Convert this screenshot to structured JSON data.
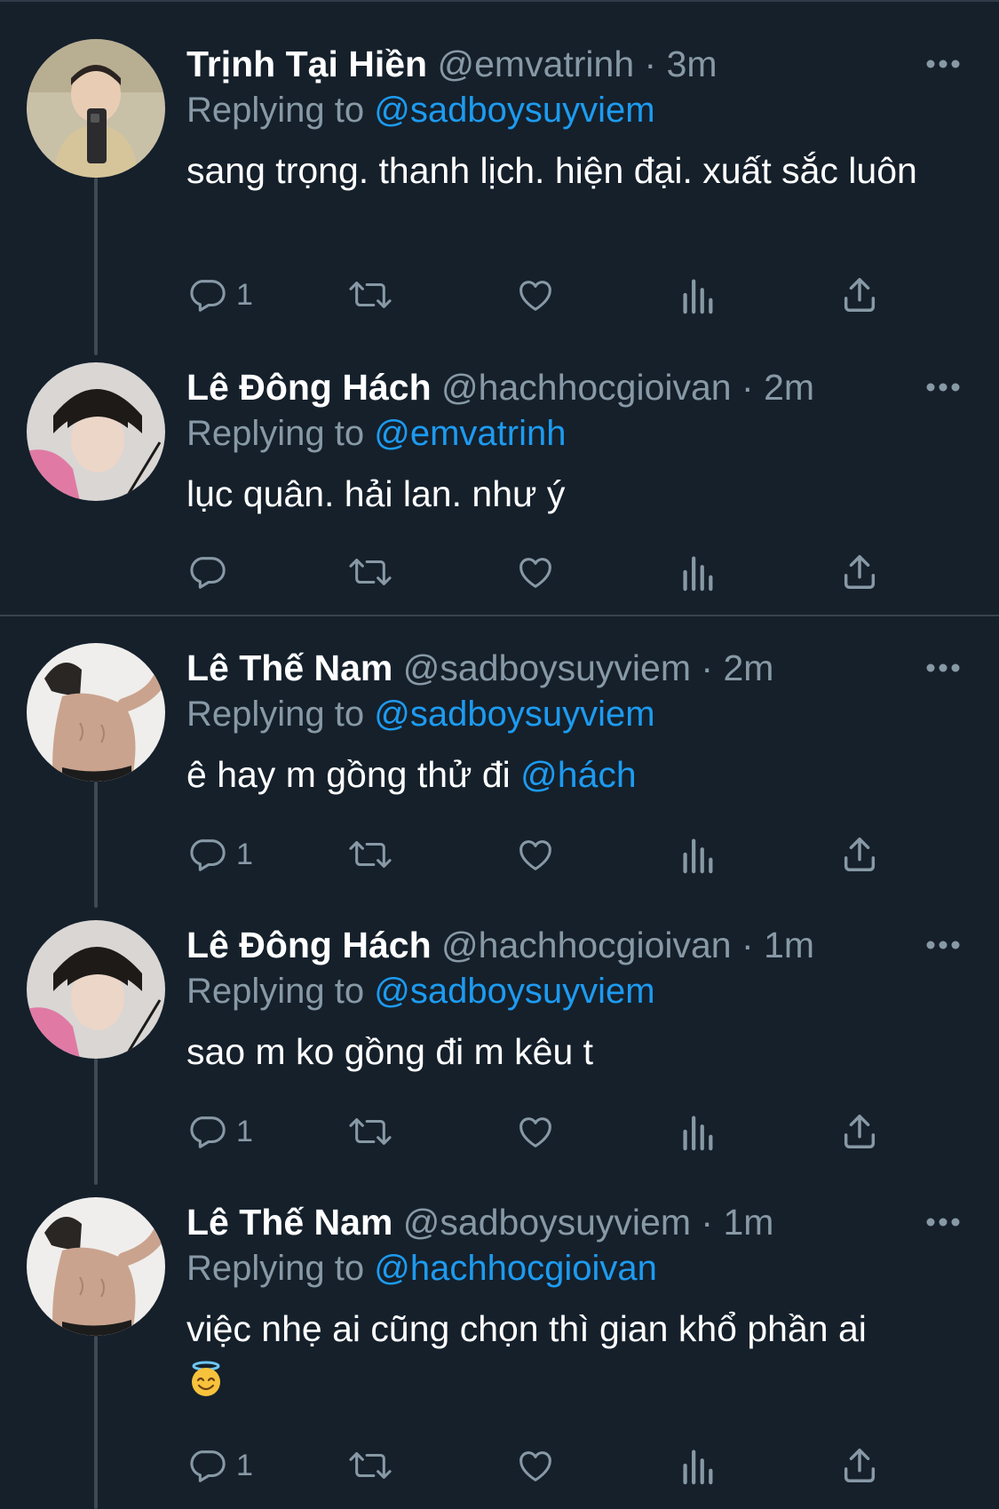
{
  "tweets": [
    {
      "display_name": "Trịnh Tại Hiền",
      "handle": "@emvatrinh",
      "separator": "·",
      "time": "3m",
      "reply_prefix": "Replying to",
      "reply_to": "@sadboysuyviem",
      "text": "sang trọng. thanh lịch. hiện đại. xuất sắc luôn",
      "reply_count": "1",
      "avatar": "avatar-photo-selfie"
    },
    {
      "display_name": "Lê Đông Hách",
      "handle": "@hachhocgioivan",
      "separator": "·",
      "time": "2m",
      "reply_prefix": "Replying to",
      "reply_to": "@emvatrinh",
      "text": "lục quân. hải lan. như ý",
      "reply_count": "",
      "avatar": "avatar-photo-pink-hoodie"
    },
    {
      "display_name": "Lê Thế Nam",
      "handle": "@sadboysuyviem",
      "separator": "·",
      "time": "2m",
      "reply_prefix": "Replying to",
      "reply_to": "@sadboysuyviem",
      "text_before_mention": "ê hay m gồng thử đi ",
      "inline_mention": "@hách",
      "reply_count": "1",
      "avatar": "avatar-photo-shirtless"
    },
    {
      "display_name": "Lê Đông Hách",
      "handle": "@hachhocgioivan",
      "separator": "·",
      "time": "1m",
      "reply_prefix": "Replying to",
      "reply_to": "@sadboysuyviem",
      "text": "sao m ko gồng đi m kêu t",
      "reply_count": "1",
      "avatar": "avatar-photo-pink-hoodie"
    },
    {
      "display_name": "Lê Thế Nam",
      "handle": "@sadboysuyviem",
      "separator": "·",
      "time": "1m",
      "reply_prefix": "Replying to",
      "reply_to": "@hachhocgioivan",
      "text": "việc nhẹ ai cũng chọn thì gian khổ phần ai",
      "emoji": "smiling-face-with-halo-emoji",
      "reply_count": "1",
      "avatar": "avatar-photo-shirtless"
    }
  ],
  "icons": {
    "reply": "speech-bubble-icon",
    "retweet": "retweet-arrows-icon",
    "like": "heart-icon",
    "analytics": "bar-chart-icon",
    "share": "share-upload-icon",
    "more": "more-dots-icon"
  },
  "colors": {
    "background": "#15202b",
    "secondary_text": "#8899a6",
    "link": "#1d9bf0",
    "divider": "#38444d"
  }
}
